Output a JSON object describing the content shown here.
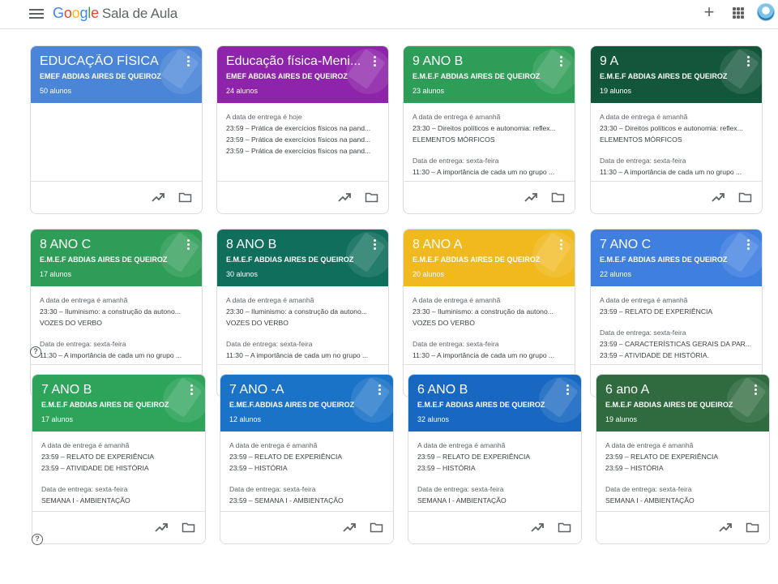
{
  "header": {
    "logo_google": [
      "G",
      "o",
      "o",
      "g",
      "l",
      "e"
    ],
    "app_name": "Sala de Aula"
  },
  "icons": {
    "menu": "hamburger-icon",
    "add": "plus-icon",
    "apps": "apps-grid-icon",
    "avatar": "school-crest-avatar",
    "trend": "trending-up-icon",
    "folder": "folder-icon",
    "help": "help-icon"
  },
  "colors": {
    "blue": "#4a85d8",
    "purple": "#8e24aa",
    "green": "#2e9d57",
    "dark_green": "#12573c",
    "teal": "#0f6e5c",
    "yellow": "#f0ba1e",
    "mid_blue": "#3f7fe0",
    "light_green": "#2ea35a",
    "royal_blue": "#1b73c8",
    "deep_blue": "#1868c1",
    "olive_green": "#2f6b3e"
  },
  "cards": [
    {
      "title": "EDUCAÇÃO FÍSICA",
      "section": "EMEF ABDIAS AIRES DE QUEIROZ",
      "students": "50 alunos",
      "color": "#4a85d8",
      "due1": "",
      "items1": [],
      "due2": "",
      "items2": []
    },
    {
      "title": "Educação física-Meni...",
      "section": "EMEF ABDIAS AIRES DE QUEIROZ",
      "students": "24 alunos",
      "color": "#8e24aa",
      "due1": "A data de entrega é hoje",
      "items1": [
        "23:59 – Prática de exercícios físicos na pand...",
        "23:59 – Prática de exercícios físicos na pand...",
        "23:59 – Prática de exercícios físicos na pand..."
      ],
      "due2": "",
      "items2": []
    },
    {
      "title": "9 ANO B",
      "section": "E.M.E.F ABDIAS AIRES DE QUEIROZ",
      "students": "23 alunos",
      "color": "#2e9d57",
      "due1": "A data de entrega é amanhã",
      "items1": [
        "23:30 – Direitos políticos e autonomia: reflex...",
        "ELEMENTOS MÓRFICOS"
      ],
      "due2": "Data de entrega: sexta-feira",
      "items2": [
        "11:30 – A importância de cada um no grupo ..."
      ]
    },
    {
      "title": "9 A",
      "section": "E.M.E.F ABDIAS AIRES DE QUEIROZ",
      "students": "19 alunos",
      "color": "#12573c",
      "due1": "A data de entrega é amanhã",
      "items1": [
        "23:30 – Direitos políticos e autonomia: reflex...",
        "ELEMENTOS MÓRFICOS"
      ],
      "due2": "Data de entrega: sexta-feira",
      "items2": [
        "11:30 – A importância de cada um no grupo ..."
      ]
    },
    {
      "title": "8 ANO C",
      "section": "E.M.E.F ABDIAS AIRES DE QUEIROZ",
      "students": "17 alunos",
      "color": "#2e9d57",
      "due1": "A data de entrega é amanhã",
      "items1": [
        "23:30 – Iluminismo: a construção da autono...",
        "VOZES DO VERBO"
      ],
      "due2": "Data de entrega: sexta-feira",
      "items2": [
        "11:30 – A importância de cada um no grupo ..."
      ]
    },
    {
      "title": "8 ANO B",
      "section": "E.M.E.F ABDIAS AIRES DE QUEIROZ",
      "students": "30 alunos",
      "color": "#0f6e5c",
      "due1": "A data de entrega é amanhã",
      "items1": [
        "23:30 – Iluminismo: a construção da autono...",
        "VOZES DO VERBO"
      ],
      "due2": "Data de entrega: sexta-feira",
      "items2": [
        "11:30 – A importância de cada um no grupo ..."
      ]
    },
    {
      "title": "8 ANO A",
      "section": "E.M.E.F ABDIAS AIRES DE QUEIROZ",
      "students": "20 alunos",
      "color": "#f0ba1e",
      "due1": "A data de entrega é amanhã",
      "items1": [
        "23:30 – Iluminismo: a construção da autono...",
        "VOZES DO VERBO"
      ],
      "due2": "Data de entrega: sexta-feira",
      "items2": [
        "11:30 – A importância de cada um no grupo ..."
      ]
    },
    {
      "title": "7 ANO C",
      "section": "E.M.E.F ABDIAS AIRES DE QUEIROZ",
      "students": "22 alunos",
      "color": "#3f7fe0",
      "due1": "A data de entrega é amanhã",
      "items1": [
        "23:59 – RELATO DE EXPERIÊNCIA"
      ],
      "due2": "Data de entrega: sexta-feira",
      "items2": [
        "23:59 – CARACTERÍSTICAS GERAIS DA PAR...",
        "23:59 – ATIVIDADE DE HISTÓRIA."
      ]
    },
    {
      "title": "7 ANO B",
      "section": "E.M.E.F ABDIAS AIRES DE QUEIROZ",
      "students": "17 alunos",
      "color": "#2ea35a",
      "due1": "A data de entrega é amanhã",
      "items1": [
        "23:59 – RELATO DE EXPERIÊNCIA",
        "23:59 – ATIVIDADE DE HISTÓRIA"
      ],
      "due2": "Data de entrega: sexta-feira",
      "items2": [
        "SEMANA I - AMBIENTAÇÃO"
      ]
    },
    {
      "title": "7 ANO -A",
      "section": "E.ME.F.ABDIAS AIRES DE QUEIROZ",
      "students": "12 alunos",
      "color": "#1b73c8",
      "due1": "A data de entrega é amanhã",
      "items1": [
        "23:59 – RELATO DE EXPERIÊNCIA",
        "23:59 – HISTÓRIA"
      ],
      "due2": "Data de entrega: sexta-feira",
      "items2": [
        "23:59 – SEMANA I - AMBIENTAÇÃO"
      ]
    },
    {
      "title": "6 ANO B",
      "section": "E.M.E.F ABDIAS AIRES DE QUEIROZ",
      "students": "32 alunos",
      "color": "#1868c1",
      "due1": "A data de entrega é amanhã",
      "items1": [
        "23:59 – RELATO DE EXPERIÊNCIA",
        "23:59 – HISTÓRIA"
      ],
      "due2": "Data de entrega: sexta-feira",
      "items2": [
        "SEMANA I - AMBIENTAÇÃO"
      ]
    },
    {
      "title": "6 ano A",
      "section": "E.M.E.F ABDIAS AIRES DE QUEIROZ",
      "students": "19 alunos",
      "color": "#2f6b3e",
      "due1": "A data de entrega é amanhã",
      "items1": [
        "23:59 – RELATO DE EXPERIÊNCIA",
        "23:59 – HISTÓRIA"
      ],
      "due2": "Data de entrega: sexta-feira",
      "items2": [
        "SEMANA I - AMBIENTAÇÃO"
      ]
    }
  ],
  "help_label": "?"
}
